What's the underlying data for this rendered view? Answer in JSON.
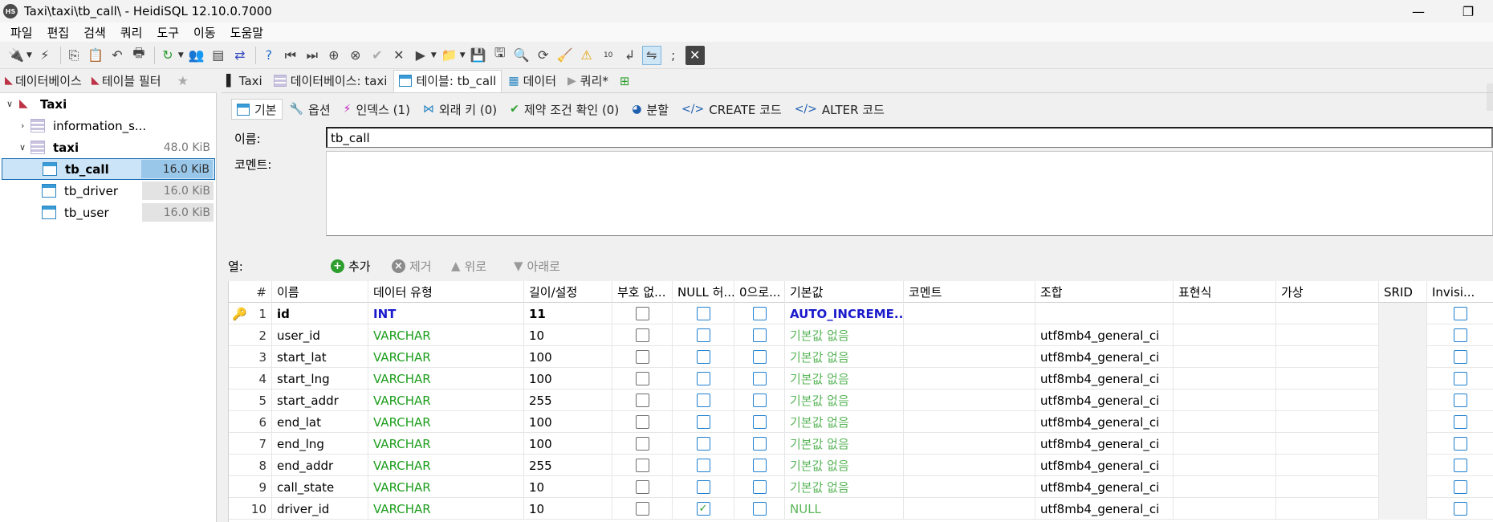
{
  "window": {
    "title": "Taxi\\taxi\\tb_call\\ - HeidiSQL 12.10.0.7000",
    "icon_text": "HS",
    "minimize_glyph": "—",
    "maximize_glyph": "❐"
  },
  "menu": [
    "파일",
    "편집",
    "검색",
    "쿼리",
    "도구",
    "이동",
    "도움말"
  ],
  "left_tabs": [
    {
      "label": "데이터베이스"
    },
    {
      "label": "테이블 필터"
    }
  ],
  "tree": {
    "root": {
      "label": "Taxi"
    },
    "items": [
      {
        "label": "information_s...",
        "size": ""
      },
      {
        "label": "taxi",
        "size": "48.0 KiB"
      },
      {
        "label": "tb_call",
        "size": "16.0 KiB"
      },
      {
        "label": "tb_driver",
        "size": "16.0 KiB"
      },
      {
        "label": "tb_user",
        "size": "16.0 KiB"
      }
    ]
  },
  "right_tabs": [
    {
      "label": "Taxi"
    },
    {
      "label": "데이터베이스: taxi"
    },
    {
      "label": "테이블: tb_call"
    },
    {
      "label": "데이터"
    },
    {
      "label": "쿼리*"
    }
  ],
  "sub_tabs": [
    {
      "label": "기본"
    },
    {
      "label": "옵션"
    },
    {
      "label": "인덱스 (1)"
    },
    {
      "label": "외래 키 (0)"
    },
    {
      "label": "제약 조건 확인 (0)"
    },
    {
      "label": "분할"
    },
    {
      "label": "CREATE 코드"
    },
    {
      "label": "ALTER 코드"
    }
  ],
  "props": {
    "name_label": "이름:",
    "name_value": "tb_call",
    "comment_label": "코멘트:"
  },
  "columns_bar": {
    "label": "열:",
    "add": "추가",
    "remove": "제거",
    "up": "위로",
    "down": "아래로"
  },
  "grid": {
    "headers": [
      "#",
      "이름",
      "데이터 유형",
      "길이/설정",
      "부호 없...",
      "NULL 허...",
      "0으로...",
      "기본값",
      "코멘트",
      "조합",
      "표현식",
      "가상",
      "SRID",
      "Invisi..."
    ],
    "rows": [
      {
        "n": "1",
        "name": "id",
        "type": "INT",
        "len": "11",
        "unsigned": false,
        "null": false,
        "zerofill": false,
        "default": "AUTO_INCREME...",
        "collation": "",
        "invisible": false
      },
      {
        "n": "2",
        "name": "user_id",
        "type": "VARCHAR",
        "len": "10",
        "unsigned": false,
        "null": false,
        "zerofill": false,
        "default": "기본값 없음",
        "collation": "utf8mb4_general_ci",
        "invisible": false
      },
      {
        "n": "3",
        "name": "start_lat",
        "type": "VARCHAR",
        "len": "100",
        "unsigned": false,
        "null": false,
        "zerofill": false,
        "default": "기본값 없음",
        "collation": "utf8mb4_general_ci",
        "invisible": false
      },
      {
        "n": "4",
        "name": "start_lng",
        "type": "VARCHAR",
        "len": "100",
        "unsigned": false,
        "null": false,
        "zerofill": false,
        "default": "기본값 없음",
        "collation": "utf8mb4_general_ci",
        "invisible": false
      },
      {
        "n": "5",
        "name": "start_addr",
        "type": "VARCHAR",
        "len": "255",
        "unsigned": false,
        "null": false,
        "zerofill": false,
        "default": "기본값 없음",
        "collation": "utf8mb4_general_ci",
        "invisible": false
      },
      {
        "n": "6",
        "name": "end_lat",
        "type": "VARCHAR",
        "len": "100",
        "unsigned": false,
        "null": false,
        "zerofill": false,
        "default": "기본값 없음",
        "collation": "utf8mb4_general_ci",
        "invisible": false
      },
      {
        "n": "7",
        "name": "end_lng",
        "type": "VARCHAR",
        "len": "100",
        "unsigned": false,
        "null": false,
        "zerofill": false,
        "default": "기본값 없음",
        "collation": "utf8mb4_general_ci",
        "invisible": false
      },
      {
        "n": "8",
        "name": "end_addr",
        "type": "VARCHAR",
        "len": "255",
        "unsigned": false,
        "null": false,
        "zerofill": false,
        "default": "기본값 없음",
        "collation": "utf8mb4_general_ci",
        "invisible": false
      },
      {
        "n": "9",
        "name": "call_state",
        "type": "VARCHAR",
        "len": "10",
        "unsigned": false,
        "null": false,
        "zerofill": false,
        "default": "기본값 없음",
        "collation": "utf8mb4_general_ci",
        "invisible": false
      },
      {
        "n": "10",
        "name": "driver_id",
        "type": "VARCHAR",
        "len": "10",
        "unsigned": false,
        "null": true,
        "zerofill": false,
        "default": "NULL",
        "collation": "utf8mb4_general_ci",
        "invisible": false
      }
    ]
  },
  "colors": {
    "selection": "#cce4f7",
    "selection_border": "#1a6fb5",
    "type_green": "#1e9e1e",
    "default_green": "#59b559",
    "auto_increment_blue": "#1a1acc",
    "key_gold": "#d9a100"
  }
}
